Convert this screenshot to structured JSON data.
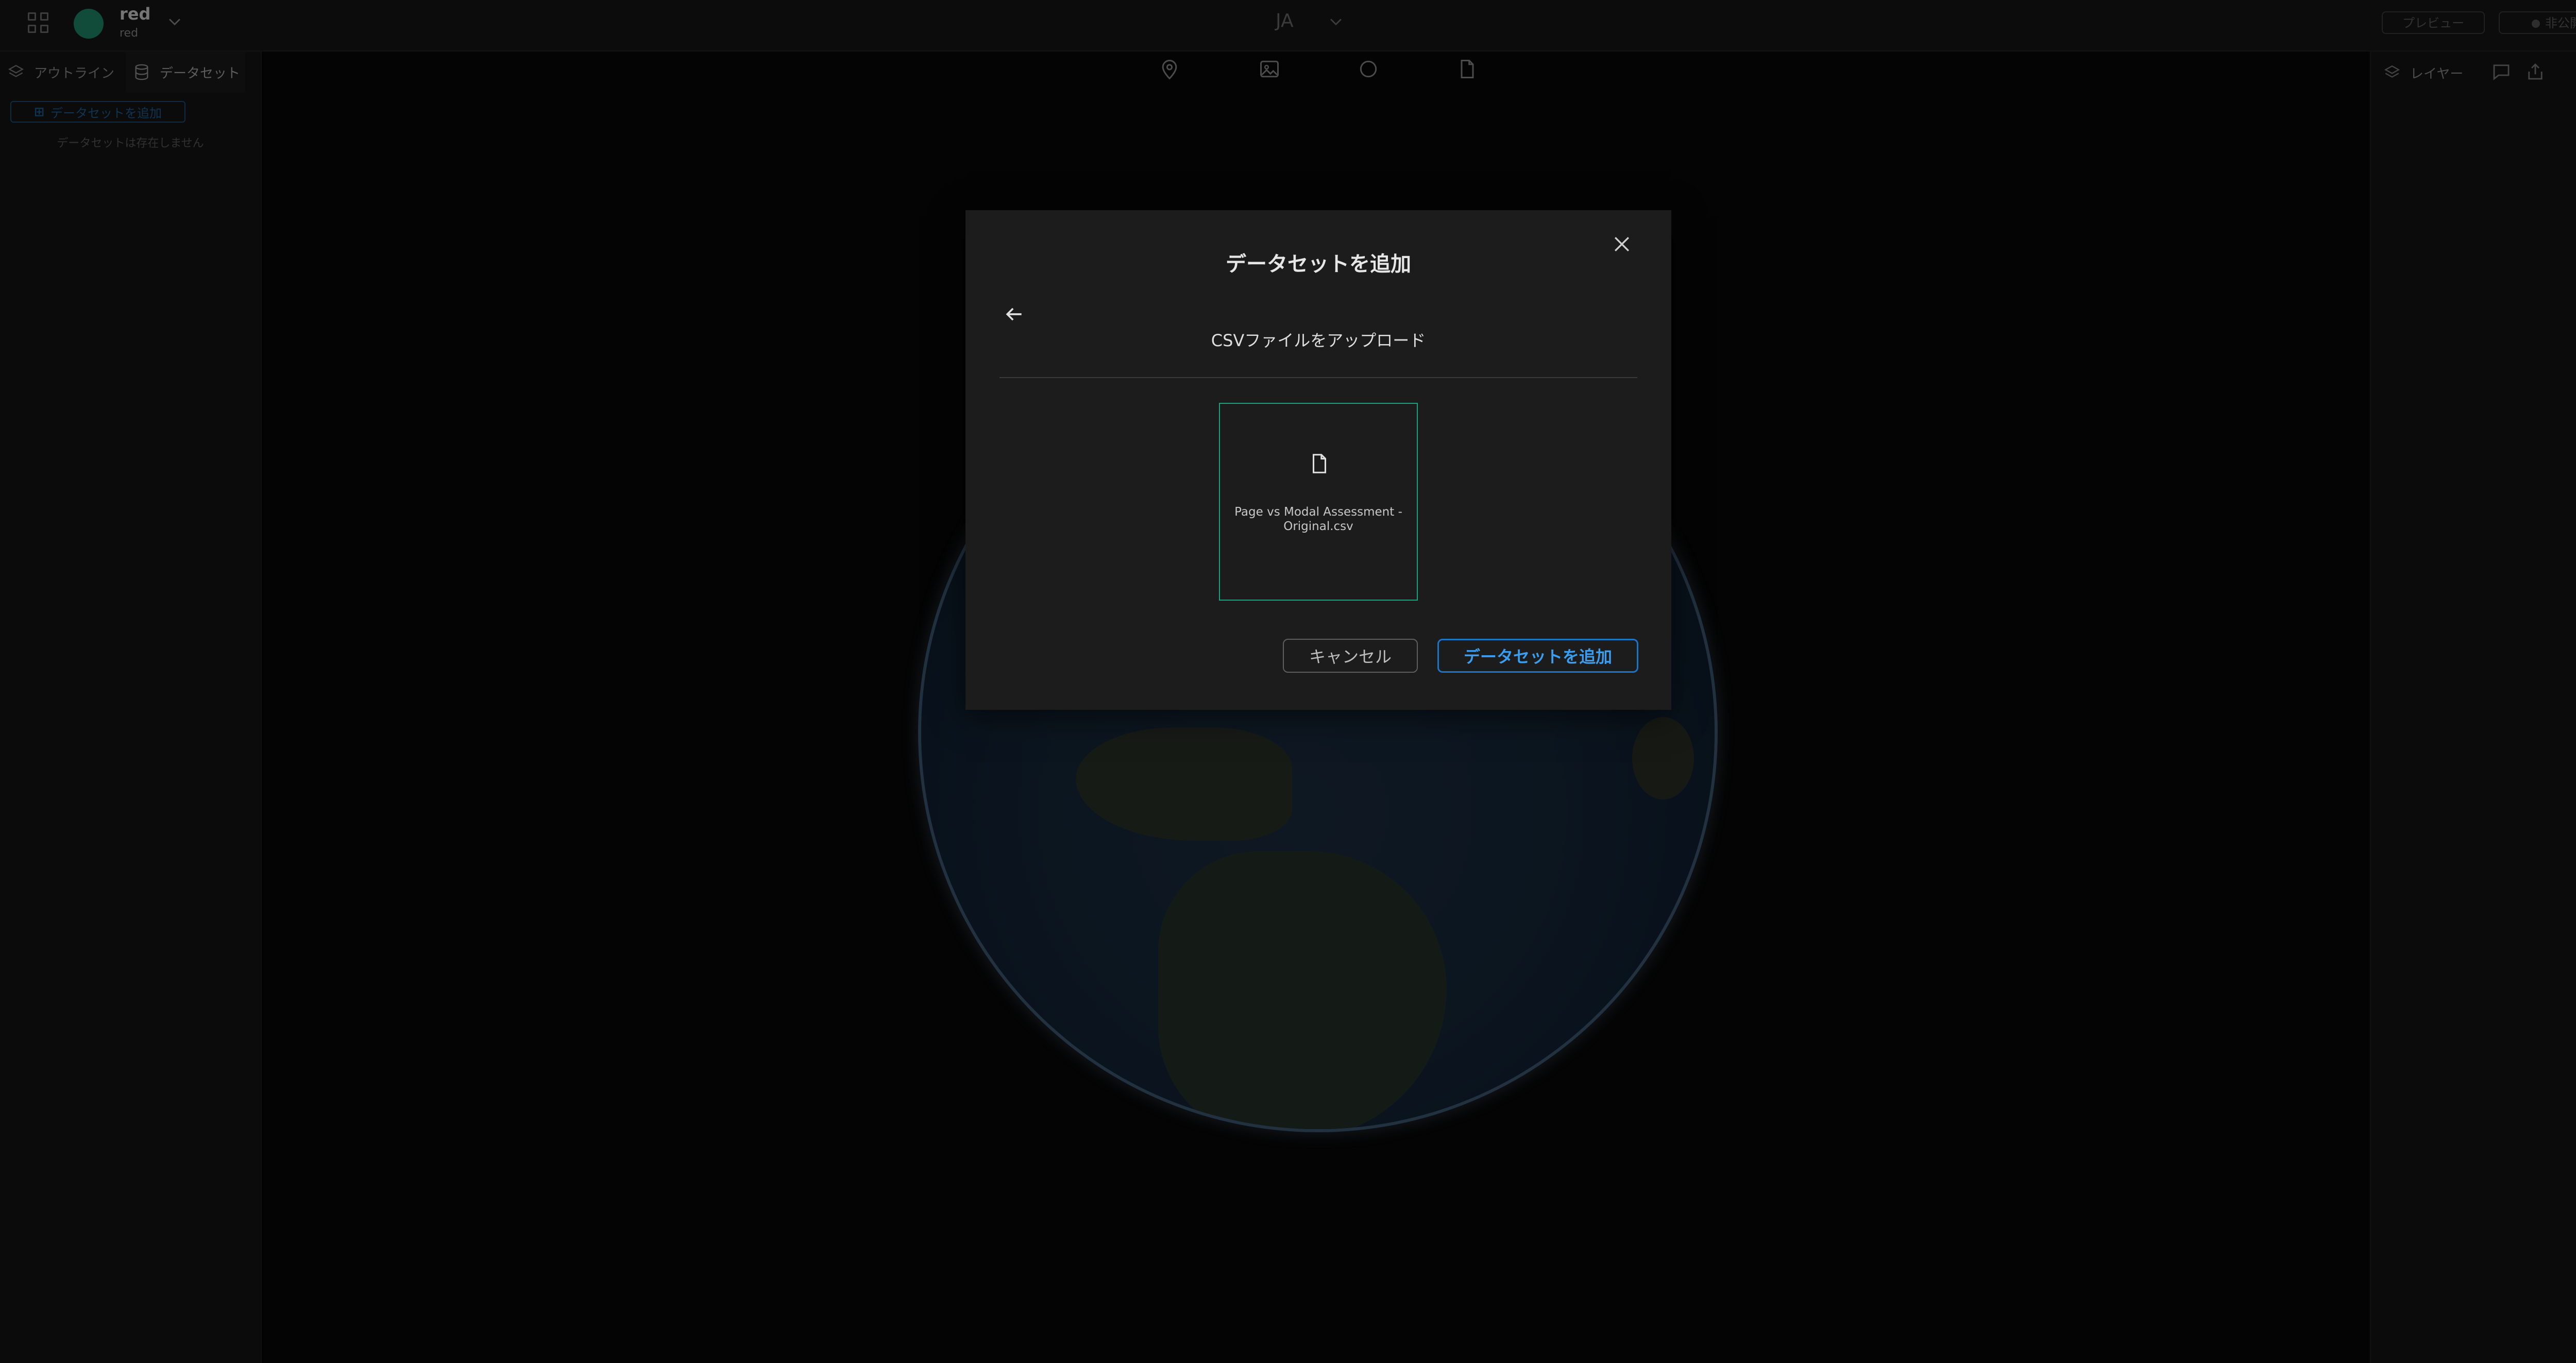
{
  "header": {
    "project_name": "red",
    "project_sub": "red",
    "language": "JA",
    "preview_label": "プレビュー",
    "publish_label": "非公開"
  },
  "left_panel": {
    "tabs": [
      {
        "label": "アウトライン",
        "icon": "layers-icon"
      },
      {
        "label": "データセット",
        "icon": "database-icon"
      }
    ],
    "active_tab": "データセット",
    "add_dataset_label": "データセットを追加",
    "empty_message": "データセットは存在しません"
  },
  "toolbar": {
    "icons": [
      "map-pin-icon",
      "image-icon",
      "circle-icon",
      "file-icon"
    ]
  },
  "right_panel": {
    "layer_label": "レイヤー",
    "icons": [
      "comment-icon",
      "share-icon"
    ]
  },
  "modal": {
    "title": "データセットを追加",
    "subtitle": "CSVファイルをアップロード",
    "file_name": "Page vs Modal Assessment - Original.csv",
    "cancel_label": "キャンセル",
    "confirm_label": "データセットを追加"
  },
  "colors": {
    "accent_blue": "#1d74c6",
    "accent_green": "#17a47c",
    "avatar": "#1f8a6a"
  }
}
